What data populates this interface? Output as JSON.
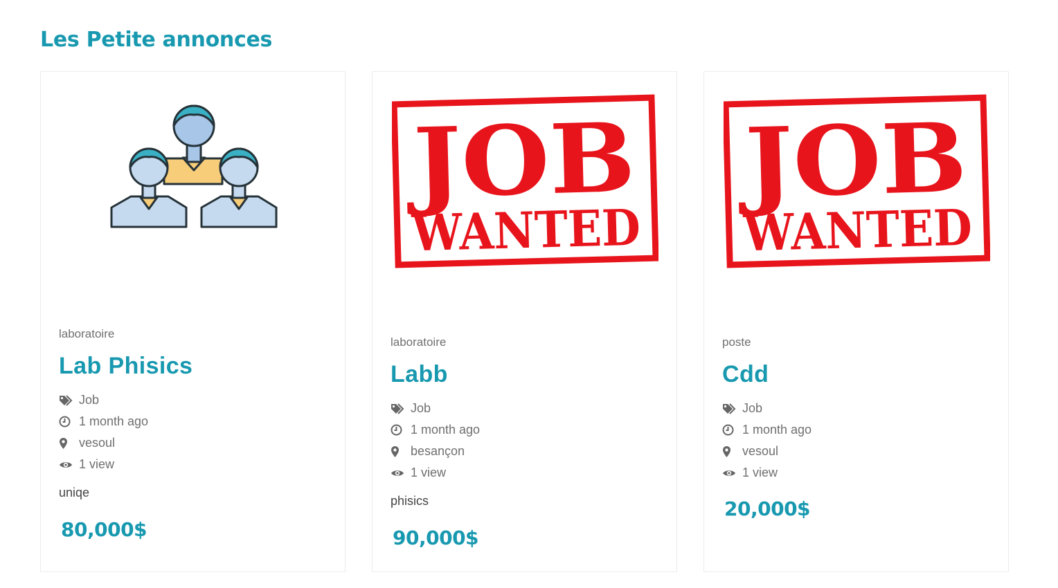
{
  "page": {
    "title": "Les Petite annonces"
  },
  "listings": [
    {
      "category": "laboratoire",
      "title": "Lab Phisics",
      "type": "Job",
      "posted": "1 month ago",
      "location": "vesoul",
      "views": "1 view",
      "description": "uniqe",
      "price": "80,000$"
    },
    {
      "category": "laboratoire",
      "title": "Labb",
      "type": "Job",
      "posted": "1 month ago",
      "location": "besançon",
      "views": "1 view",
      "description": "phisics",
      "price": "90,000$",
      "image": {
        "line1": "JOB",
        "line2": "WANTED"
      }
    },
    {
      "category": "poste",
      "title": "Cdd",
      "type": "Job",
      "posted": "1 month ago",
      "location": "vesoul",
      "views": "1 view",
      "description": "",
      "price": "20,000$",
      "image": {
        "line1": "JOB",
        "line2": "WANTED"
      }
    }
  ],
  "icons": {
    "type": "tags-icon",
    "posted": "clock-icon",
    "location": "map-marker-icon",
    "views": "eye-icon"
  },
  "colors": {
    "accent": "#1899b0",
    "stamp": "#e8141c",
    "muted": "#6f6f6f"
  }
}
